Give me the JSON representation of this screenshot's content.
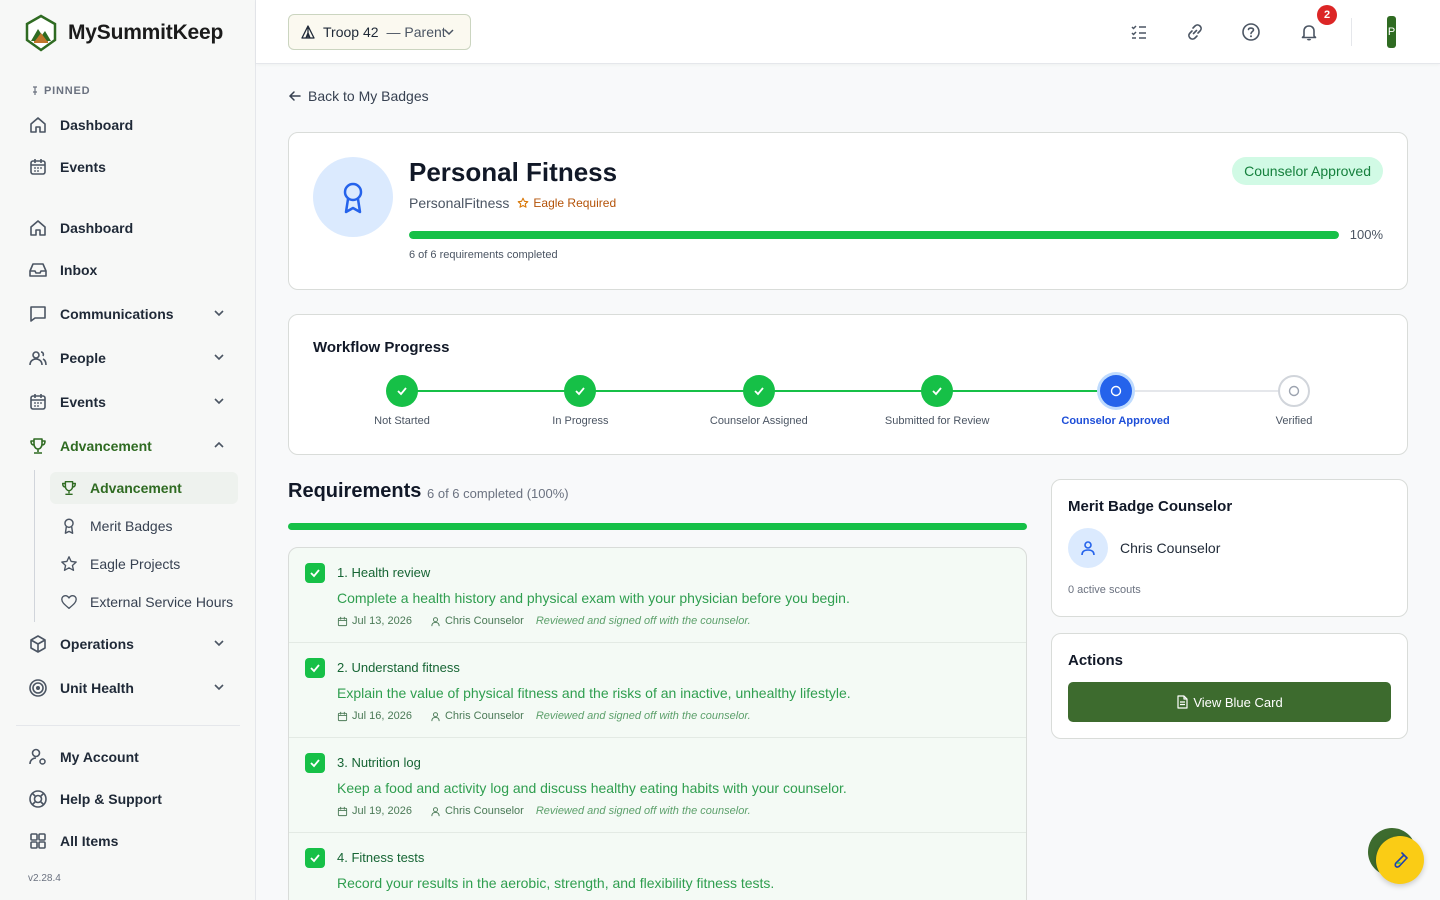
{
  "app": {
    "name": "MySummitKeep",
    "version": "v2.28.4"
  },
  "sidebar": {
    "pinned_label": "PINNED",
    "pinned": [
      {
        "label": "Dashboard",
        "icon": "home-icon"
      },
      {
        "label": "Events",
        "icon": "calendar-icon"
      }
    ],
    "items": [
      {
        "label": "Dashboard",
        "icon": "home-icon"
      },
      {
        "label": "Inbox",
        "icon": "inbox-icon"
      },
      {
        "label": "Communications",
        "icon": "message-icon"
      },
      {
        "label": "People",
        "icon": "people-icon"
      },
      {
        "label": "Events",
        "icon": "calendar-icon"
      },
      {
        "label": "Advancement",
        "icon": "trophy-icon"
      },
      {
        "label": "Operations",
        "icon": "box-icon"
      },
      {
        "label": "Unit Health",
        "icon": "target-icon"
      }
    ],
    "advancement_sub": [
      {
        "label": "Advancement",
        "icon": "trophy-icon"
      },
      {
        "label": "Merit Badges",
        "icon": "ribbon-icon"
      },
      {
        "label": "Eagle Projects",
        "icon": "star-icon"
      },
      {
        "label": "External Service Hours",
        "icon": "heart-icon"
      }
    ],
    "bottom": [
      {
        "label": "My Account",
        "icon": "user-gear-icon"
      },
      {
        "label": "Help & Support",
        "icon": "lifebuoy-icon"
      },
      {
        "label": "All Items",
        "icon": "grid-icon"
      }
    ]
  },
  "topbar": {
    "troop": "Troop 42",
    "role": "— Parent",
    "notifications": "2",
    "avatar_initial": "P"
  },
  "back_link": "Back to My Badges",
  "badge": {
    "title": "Personal Fitness",
    "code": "PersonalFitness",
    "eagle_label": "Eagle Required",
    "status": "Counselor Approved",
    "progress_pct": "100%",
    "progress_value": 1.0,
    "progress_caption": "6 of 6 requirements completed"
  },
  "workflow": {
    "title": "Workflow Progress",
    "steps": [
      {
        "label": "Not Started",
        "state": "done"
      },
      {
        "label": "In Progress",
        "state": "done"
      },
      {
        "label": "Counselor Assigned",
        "state": "done"
      },
      {
        "label": "Submitted for Review",
        "state": "done"
      },
      {
        "label": "Counselor Approved",
        "state": "current"
      },
      {
        "label": "Verified",
        "state": "pending"
      }
    ]
  },
  "requirements": {
    "title": "Requirements",
    "count": "6 of 6 completed (100%)",
    "items": [
      {
        "name": "1. Health review",
        "desc": "Complete a health history and physical exam with your physician before you begin.",
        "date": "Jul 13, 2026",
        "counselor": "Chris Counselor",
        "note": "Reviewed and signed off with the counselor."
      },
      {
        "name": "2. Understand fitness",
        "desc": "Explain the value of physical fitness and the risks of an inactive, unhealthy lifestyle.",
        "date": "Jul 16, 2026",
        "counselor": "Chris Counselor",
        "note": "Reviewed and signed off with the counselor."
      },
      {
        "name": "3. Nutrition log",
        "desc": "Keep a food and activity log and discuss healthy eating habits with your counselor.",
        "date": "Jul 19, 2026",
        "counselor": "Chris Counselor",
        "note": "Reviewed and signed off with the counselor."
      },
      {
        "name": "4. Fitness tests",
        "desc": "Record your results in the aerobic, strength, and flexibility fitness tests.",
        "date": "",
        "counselor": "",
        "note": ""
      }
    ]
  },
  "counselor_card": {
    "title": "Merit Badge Counselor",
    "name": "Chris Counselor",
    "active_scouts": "0 active scouts"
  },
  "actions_card": {
    "title": "Actions",
    "blue_card_label": "View Blue Card"
  },
  "colors": {
    "brand": "#2f6b22",
    "success": "#16c047",
    "current": "#2563eb",
    "fab": "#facc15"
  }
}
